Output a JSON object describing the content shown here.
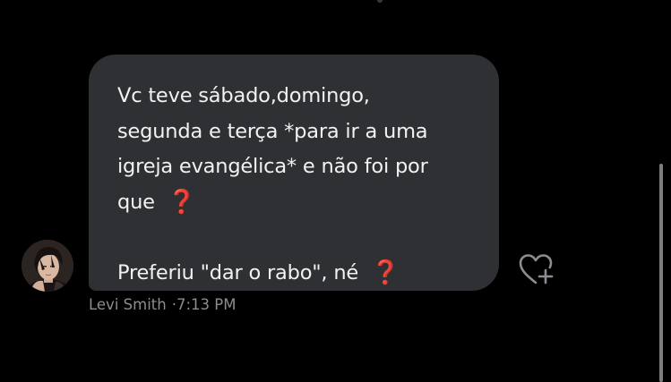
{
  "message": {
    "lines": [
      "Vc teve sábado,domingo,",
      "segunda e terça *para ir a uma",
      "igreja evangélica* e não foi por",
      "que"
    ],
    "line5": "Preferiu \"dar o rabo\", né",
    "question_mark_emoji": "❓"
  },
  "sender": {
    "name": "Levi Smith",
    "time": "·7:13 PM"
  },
  "colors": {
    "background": "#000000",
    "bubble": "#2f3033",
    "text": "#f2f2f2",
    "meta": "#8a8d91",
    "emoji_red": "#d92a2a"
  },
  "icons": {
    "reaction": "heart-plus-icon",
    "avatar": "profile-avatar"
  }
}
